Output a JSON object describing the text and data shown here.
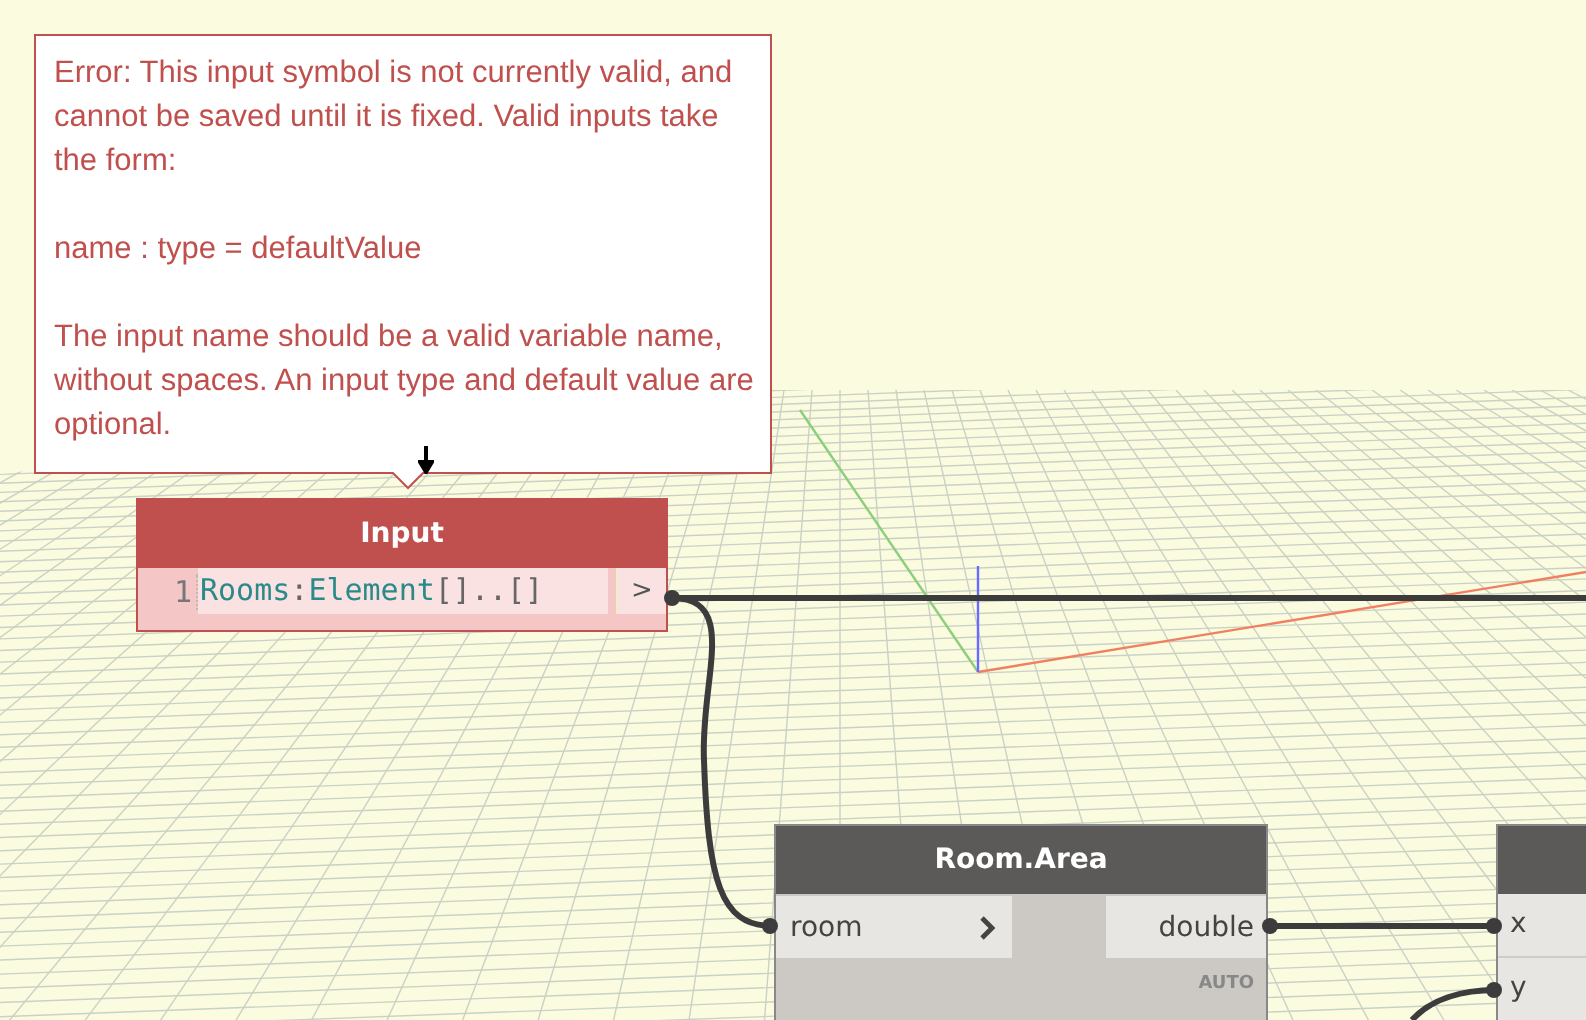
{
  "tooltip": {
    "paragraphs": [
      "Error: This input symbol is not currently valid, and cannot be saved until it is fixed. Valid inputs take the form:",
      "name : type = defaultValue",
      "The input name should be a valid variable name, without spaces. An input type and default value are optional."
    ]
  },
  "input_node": {
    "title": "Input",
    "error": true,
    "line_number": "1",
    "code": [
      {
        "kind": "identifier",
        "text": "Rooms"
      },
      {
        "kind": "punctuation",
        "text": ":"
      },
      {
        "kind": "identifier",
        "text": "Element"
      },
      {
        "kind": "punctuation",
        "text": "[]..[]"
      }
    ],
    "output_port": ">"
  },
  "room_area_node": {
    "title": "Room.Area",
    "input_port": "room",
    "output_port": "double",
    "lacing": "AUTO"
  },
  "partial_node": {
    "input_ports": [
      "x",
      "y"
    ]
  }
}
